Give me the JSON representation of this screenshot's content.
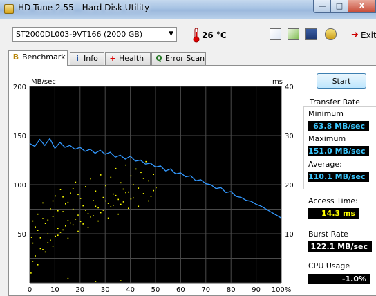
{
  "window": {
    "title": "HD Tune 2.55 - Hard Disk Utility",
    "minimize": "—",
    "maximize": "□",
    "close": "X"
  },
  "toolbar": {
    "drive": "ST2000DL003-9VT166 (2000 GB)",
    "temperature": "26 °C",
    "exit_label": "Exit",
    "icons": [
      "copy-text-icon",
      "copy-screenshot-icon",
      "save-icon",
      "options-icon",
      "exit-icon"
    ]
  },
  "tabs": [
    {
      "label": "Benchmark",
      "icon": "B",
      "active": true
    },
    {
      "label": "Info",
      "icon": "i",
      "active": false
    },
    {
      "label": "Health",
      "icon": "+",
      "active": false
    },
    {
      "label": "Error Scan",
      "icon": "Q",
      "active": false
    }
  ],
  "stats": {
    "start_label": "Start",
    "transfer_rate_label": "Transfer Rate",
    "minimum_label": "Minimum",
    "minimum_value": "63.8 MB/sec",
    "maximum_label": "Maximum",
    "maximum_value": "151.0 MB/sec",
    "average_label": "Average:",
    "average_value": "110.1 MB/sec",
    "access_time_label": "Access Time:",
    "access_time_value": "14.3 ms",
    "burst_rate_label": "Burst Rate",
    "burst_rate_value": "122.1 MB/sec",
    "cpu_usage_label": "CPU Usage",
    "cpu_usage_value": "-1.0%"
  },
  "colors": {
    "transfer_line": "#3399ff",
    "access_points": "#ffff00",
    "chart_bg": "#000000",
    "grid": "#4a4a4a"
  },
  "chart_data": {
    "type": "line",
    "ylabel": "MB/sec",
    "ylabel_right": "ms",
    "xlim": [
      0,
      100
    ],
    "ylim": [
      0,
      200
    ],
    "ylim_right": [
      0,
      40
    ],
    "x_ticks": [
      "0",
      "10",
      "20",
      "30",
      "40",
      "50",
      "60",
      "70",
      "80",
      "90",
      "100%"
    ],
    "y_ticks": [
      "200",
      "150",
      "100",
      "50"
    ],
    "y_ticks_right": [
      "40",
      "30",
      "20",
      "10"
    ],
    "grid": true,
    "series": [
      {
        "values_x": [
          0,
          2,
          4,
          6,
          8,
          10,
          12,
          14,
          16,
          18,
          20,
          22,
          24,
          26,
          28,
          30,
          32,
          34,
          36,
          38,
          40,
          42,
          44,
          46,
          48,
          50,
          52,
          54,
          56,
          58,
          60,
          62,
          64,
          66,
          68,
          70,
          72,
          74,
          76,
          78,
          80,
          82,
          84,
          86,
          88,
          90,
          92,
          94,
          96,
          98,
          100
        ],
        "values_y": [
          142,
          139,
          146,
          140,
          147,
          137,
          143,
          138,
          140,
          136,
          138,
          134,
          136,
          132,
          135,
          131,
          133,
          128,
          130,
          126,
          129,
          124,
          125,
          121,
          122,
          118,
          119,
          114,
          116,
          111,
          112,
          108,
          109,
          104,
          105,
          101,
          100,
          96,
          97,
          92,
          93,
          88,
          87,
          84,
          83,
          80,
          78,
          75,
          72,
          69,
          66
        ]
      },
      {
        "type": "scatter",
        "axis": "right",
        "points": [
          [
            1,
            8.2
          ],
          [
            2,
            11.5
          ],
          [
            3,
            14.1
          ],
          [
            4,
            9.3
          ],
          [
            5,
            16.4
          ],
          [
            6,
            12.2
          ],
          [
            7,
            10.1
          ],
          [
            8,
            15.2
          ],
          [
            9,
            13.6
          ],
          [
            10,
            17.8
          ],
          [
            11,
            11.2
          ],
          [
            12,
            19.1
          ],
          [
            13,
            14.6
          ],
          [
            14,
            16.2
          ],
          [
            15,
            12.8
          ],
          [
            16,
            18.4
          ],
          [
            17,
            15.1
          ],
          [
            18,
            20.6
          ],
          [
            19,
            13.9
          ],
          [
            20,
            17.3
          ],
          [
            21,
            15.8
          ],
          [
            22,
            19.7
          ],
          [
            23,
            14.2
          ],
          [
            24,
            21.3
          ],
          [
            25,
            16.9
          ],
          [
            26,
            18.8
          ],
          [
            27,
            15.4
          ],
          [
            28,
            22.1
          ],
          [
            29,
            17.5
          ],
          [
            30,
            19.9
          ],
          [
            31,
            16.3
          ],
          [
            32,
            21.6
          ],
          [
            33,
            18.2
          ],
          [
            34,
            23.4
          ],
          [
            35,
            17.1
          ],
          [
            36,
            20.5
          ],
          [
            37,
            19.2
          ],
          [
            38,
            24.1
          ],
          [
            39,
            18.6
          ],
          [
            40,
            21.9
          ],
          [
            41,
            20.1
          ],
          [
            42,
            23.3
          ],
          [
            43,
            19.4
          ],
          [
            44,
            22.6
          ],
          [
            45,
            18.3
          ],
          [
            46,
            24.8
          ],
          [
            47,
            20.9
          ],
          [
            48,
            17.7
          ],
          [
            49,
            22.2
          ],
          [
            50,
            19.5
          ],
          [
            2,
            5.6
          ],
          [
            4,
            7.1
          ],
          [
            6,
            6.4
          ],
          [
            8,
            8.8
          ],
          [
            10,
            9.6
          ],
          [
            12,
            10.4
          ],
          [
            14,
            11.7
          ],
          [
            16,
            12.3
          ],
          [
            18,
            13.1
          ],
          [
            20,
            12.6
          ],
          [
            22,
            14.9
          ],
          [
            24,
            13.5
          ],
          [
            26,
            15.7
          ],
          [
            28,
            14.4
          ],
          [
            30,
            16.8
          ],
          [
            32,
            15.6
          ],
          [
            34,
            17.9
          ],
          [
            36,
            16.1
          ],
          [
            38,
            18.5
          ],
          [
            40,
            17.2
          ],
          [
            3,
            3.8
          ],
          [
            5,
            6.9
          ],
          [
            7,
            8.3
          ],
          [
            9,
            7.6
          ],
          [
            11,
            9.8
          ],
          [
            13,
            10.9
          ],
          [
            15,
            9.2
          ],
          [
            17,
            11.9
          ],
          [
            19,
            10.6
          ],
          [
            21,
            12.1
          ],
          [
            23,
            11.4
          ],
          [
            25,
            13.8
          ],
          [
            27,
            12.7
          ],
          [
            29,
            14.9
          ],
          [
            31,
            13.3
          ],
          [
            33,
            15.9
          ],
          [
            35,
            14.1
          ],
          [
            37,
            16.6
          ],
          [
            39,
            15.3
          ],
          [
            41,
            17.4
          ],
          [
            1,
            12.7
          ],
          [
            3,
            10.8
          ],
          [
            5,
            13.2
          ],
          [
            7,
            12.9
          ],
          [
            9,
            16.8
          ],
          [
            11,
            14.8
          ],
          [
            13,
            17.6
          ],
          [
            15,
            16.5
          ],
          [
            17,
            19.3
          ],
          [
            19,
            18.1
          ],
          [
            43,
            15.7
          ],
          [
            45,
            21.4
          ],
          [
            47,
            16.8
          ],
          [
            49,
            18.9
          ],
          [
            1,
            4.5
          ],
          [
            0.5,
            9.4
          ],
          [
            0.3,
            2.1
          ],
          [
            26,
            0.4
          ],
          [
            36,
            0.5
          ],
          [
            15,
            1.0
          ]
        ]
      }
    ]
  }
}
